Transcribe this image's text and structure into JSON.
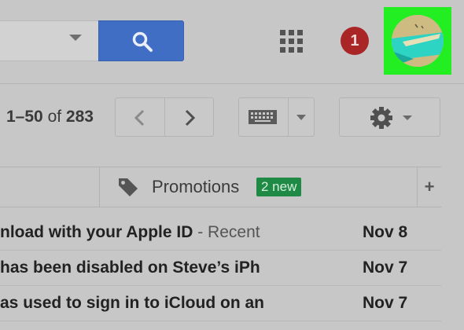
{
  "header": {
    "notification_count": "1",
    "brand_green": "#22ee22",
    "search_button_color": "#3f6ec4"
  },
  "toolbar": {
    "range": "1–50",
    "of_word": "of",
    "total": "283"
  },
  "tabs": {
    "promotions_label": "Promotions",
    "promotions_badge": "2 new",
    "add_tab": "+"
  },
  "emails": [
    {
      "subject": "nload with your Apple ID",
      "snippet": " - Recent",
      "date": "Nov 8"
    },
    {
      "subject": "has been disabled on Steve’s iPh",
      "snippet": "",
      "date": "Nov 7"
    },
    {
      "subject": "as used to sign in to iCloud on an",
      "snippet": "",
      "date": "Nov 7"
    }
  ],
  "icons": [
    "search-icon",
    "apps-grid-icon",
    "avatar",
    "chevron-left-icon",
    "chevron-right-icon",
    "keyboard-icon",
    "gear-icon",
    "tag-icon"
  ]
}
